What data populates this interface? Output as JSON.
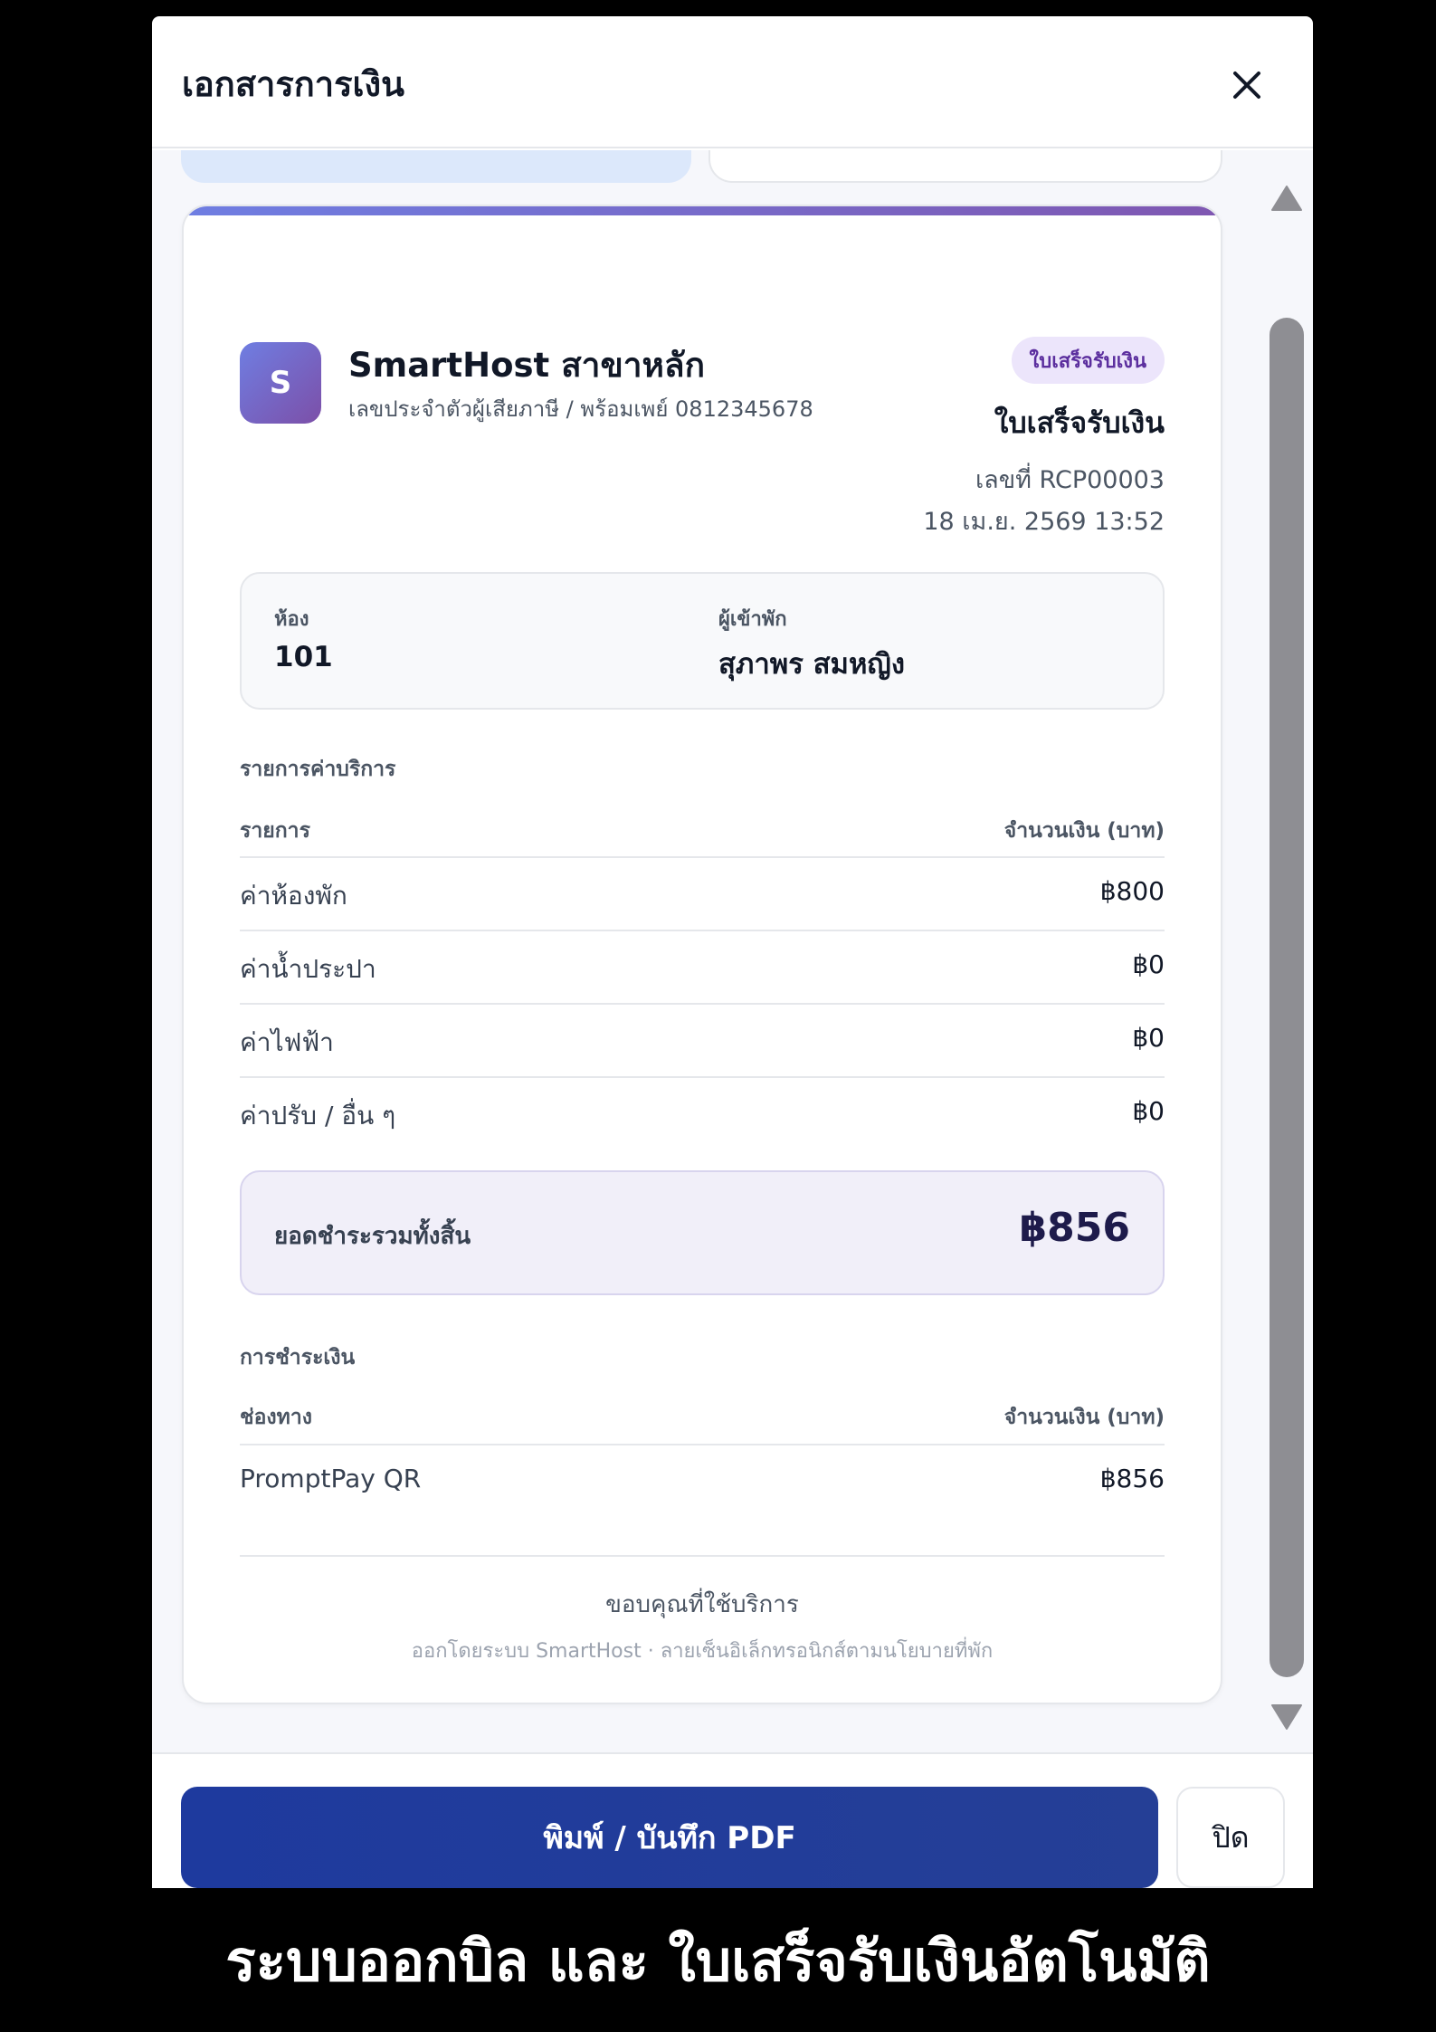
{
  "modal": {
    "title": "เอกสารการเงิน"
  },
  "business": {
    "logo_letter": "S",
    "name": "SmartHost สาขาหลัก",
    "subline": "เลขประจำตัวผู้เสียภาษี / พร้อมเพย์ 0812345678"
  },
  "document": {
    "badge": "ใบเสร็จรับเงิน",
    "type": "ใบเสร็จรับเงิน",
    "number": "เลขที่ RCP00003",
    "datetime": "18 เม.ย. 2569 13:52"
  },
  "info": {
    "room_label": "ห้อง",
    "room_value": "101",
    "guest_label": "ผู้เข้าพัก",
    "guest_value": "สุภาพร สมหญิง"
  },
  "charges": {
    "section_title": "รายการค่าบริการ",
    "col_item": "รายการ",
    "col_amount": "จำนวนเงิน (บาท)",
    "rows": [
      {
        "label": "ค่าห้องพัก",
        "amount": "฿800"
      },
      {
        "label": "ค่าน้ำประปา",
        "amount": "฿0"
      },
      {
        "label": "ค่าไฟฟ้า",
        "amount": "฿0"
      },
      {
        "label": "ค่าปรับ / อื่น ๆ",
        "amount": "฿0"
      }
    ]
  },
  "total": {
    "label": "ยอดชำระรวมทั้งสิ้น",
    "amount": "฿856"
  },
  "payments": {
    "section_title": "การชำระเงิน",
    "col_channel": "ช่องทาง",
    "col_amount": "จำนวนเงิน (บาท)",
    "rows": [
      {
        "channel": "PromptPay QR",
        "amount": "฿856"
      }
    ]
  },
  "footer": {
    "thanks": "ขอบคุณที่ใช้บริการ",
    "issued_by": "ออกโดยระบบ SmartHost · ลายเซ็นอิเล็กทรอนิกส์ตามนโยบายที่พัก"
  },
  "actions": {
    "print_label": "พิมพ์ / บันทึก PDF",
    "close_label": "ปิด"
  },
  "caption": "ระบบออกบิล และ ใบเสร็จรับเงินอัตโนมัติ",
  "colors": {
    "accent_gradient_start": "#6f7ee2",
    "accent_gradient_end": "#7f57b1",
    "primary_button": "#1e3a9e",
    "badge_bg": "#ece5fb",
    "badge_text": "#5b2e9e"
  },
  "icons": {
    "close": "close-icon",
    "scroll_up": "triangle-up-icon",
    "scroll_down": "triangle-down-icon"
  }
}
